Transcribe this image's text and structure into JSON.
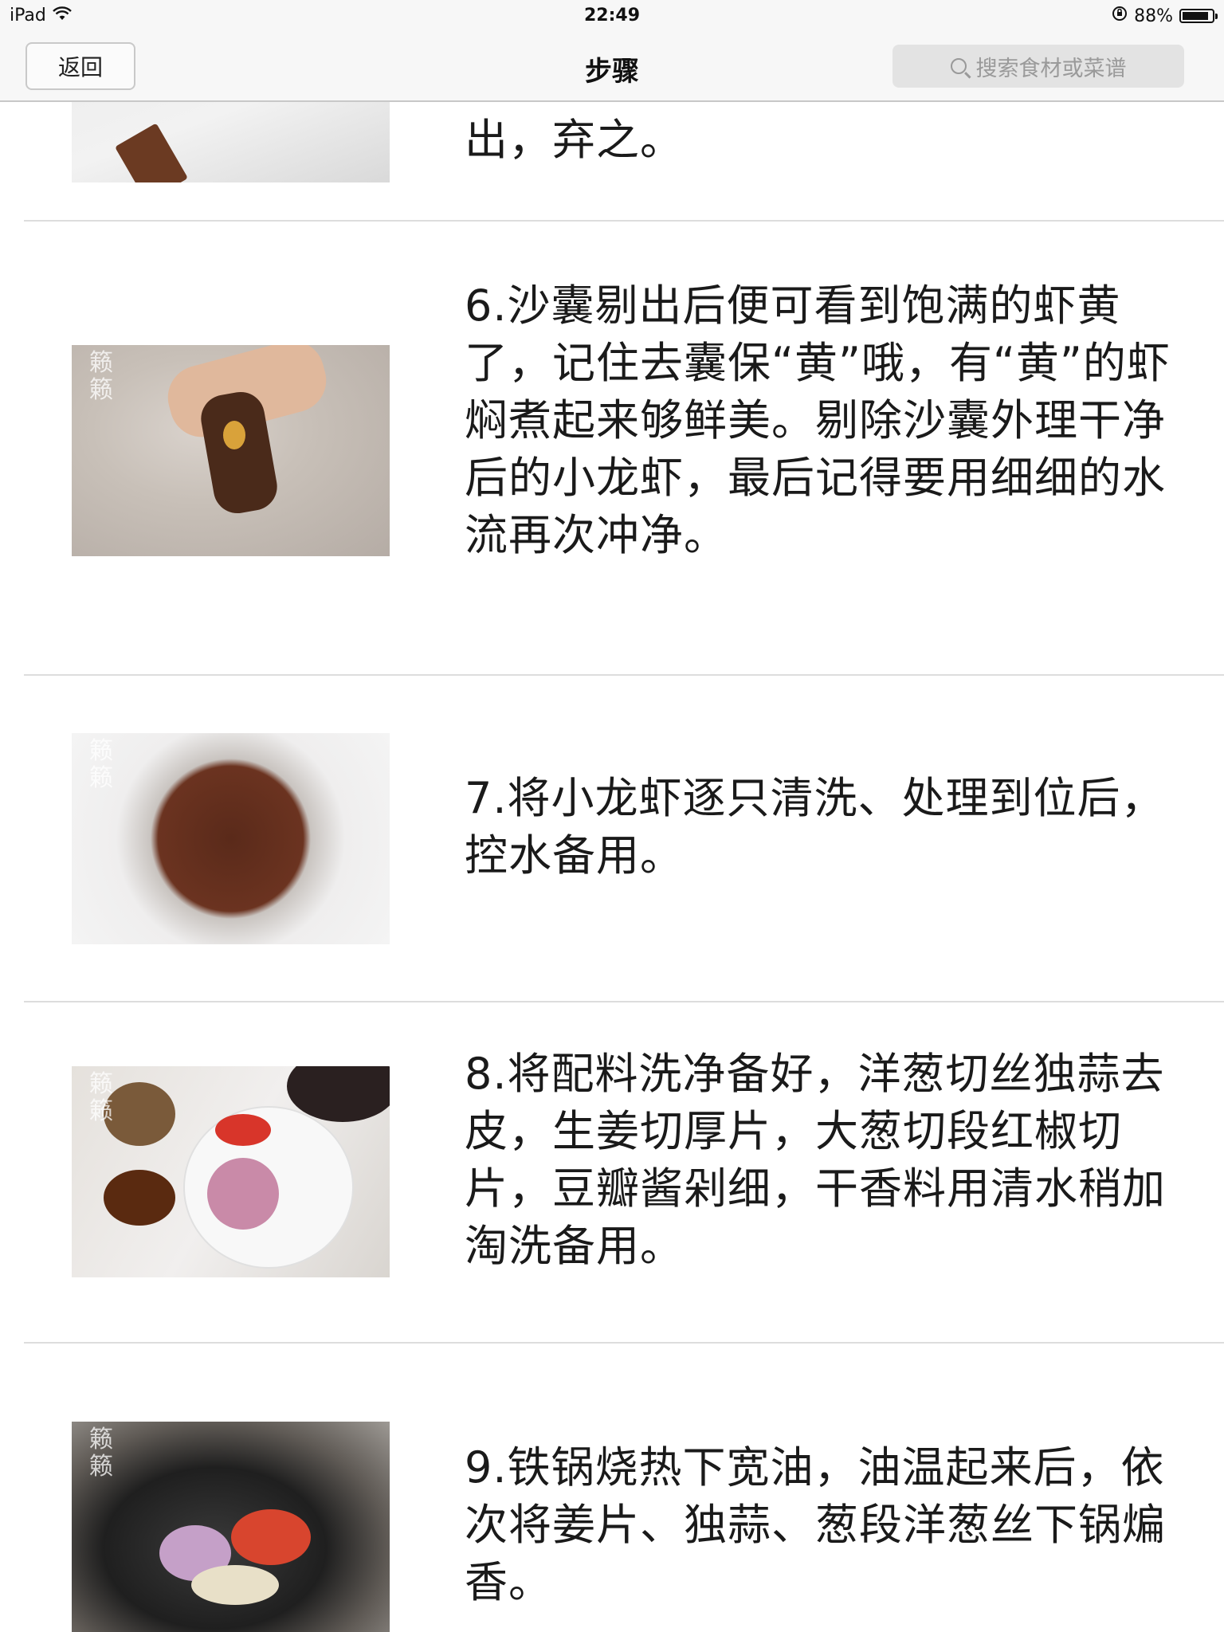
{
  "status_bar": {
    "device": "iPad",
    "time": "22:49",
    "battery": "88%",
    "battery_level": 0.88
  },
  "nav": {
    "back_label": "返回",
    "title": "步骤",
    "search_placeholder": "搜索食材或菜谱"
  },
  "steps": [
    {
      "text": "出，弃之。"
    },
    {
      "text": "6.沙囊剔出后便可看到饱满的虾黄了，记住去囊保“黄”哦，有“黄”的虾焖煮起来够鲜美。剔除沙囊外理干净后的小龙虾，最后记得要用细细的水流再次冲净。"
    },
    {
      "text": "7.将小龙虾逐只清洗、处理到位后，控水备用。"
    },
    {
      "text": "8.将配料洗净备好，洋葱切丝独蒜去皮，生姜切厚片，大葱切段红椒切片，豆瓣酱剁细，干香料用清水稍加淘洗备用。"
    },
    {
      "text": "9.铁锅烧热下宽油，油温起来后，依次将姜片、独蒜、葱段洋葱丝下锅煸香。"
    }
  ],
  "colors": {
    "bar_background": "#f7f7f7",
    "divider": "#dddddd",
    "search_background": "#e3e3e3",
    "placeholder_text": "#9a9a9a"
  }
}
